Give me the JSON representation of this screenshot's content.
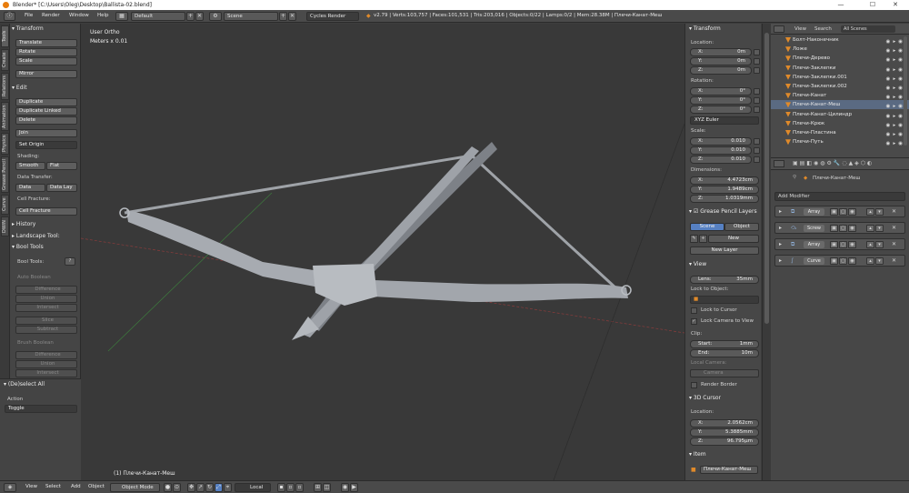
{
  "window": {
    "title": "Blender* [C:\\Users\\Oleg\\Desktop\\Ballista-02.blend]",
    "minimize": "—",
    "maximize": "☐",
    "close": "✕"
  },
  "topbar": {
    "menus": [
      "File",
      "Render",
      "Window",
      "Help"
    ],
    "screen_layout": "Default",
    "scene": "Scene",
    "engine": "Cycles Render",
    "stats": "v2.79 | Verts:103,757 | Faces:101,531 | Tris:203,016 | Objects:0/22 | Lamps:0/2 | Mem:28.38M | Плечи-Канат-Меш"
  },
  "vtabs": [
    "Tools",
    "Create",
    "Relations",
    "Animation",
    "Physics",
    "Grease Pencil",
    "Curve",
    "DWiN"
  ],
  "toolshelf": {
    "transform_header": "Transform",
    "translate": "Translate",
    "rotate": "Rotate",
    "scale": "Scale",
    "mirror": "Mirror",
    "edit_header": "Edit",
    "duplicate": "Duplicate",
    "duplicate_linked": "Duplicate Linked",
    "delete": "Delete",
    "join": "Join",
    "set_origin": "Set Origin",
    "shading_label": "Shading:",
    "smooth": "Smooth",
    "flat": "Flat",
    "data_transfer_label": "Data Transfer:",
    "data": "Data",
    "data_lay": "Data Lay",
    "cell_fracture_label": "Cell Fracture:",
    "cell_fracture": "Cell Fracture",
    "history": "History",
    "landscape_tools": "Landscape Tool:",
    "bool_tools_header": "Bool Tools",
    "bool_tools_label": "Bool Tools:",
    "auto_boolean": "Auto Boolean",
    "difference": "Difference",
    "union": "Union",
    "intersect": "Intersect",
    "slice": "Slice",
    "subtract": "Subtract",
    "brush_boolean": "Brush Boolean",
    "difference2": "Difference",
    "union2": "Union",
    "intersect2": "Intersect"
  },
  "operator_panel": {
    "header": "(De)select All",
    "action_label": "Action",
    "action_value": "Toggle"
  },
  "viewport": {
    "view_name": "User Ortho",
    "units": "Meters x 0.01",
    "object_label": "(1) Плечи-Канат-Меш"
  },
  "npanel": {
    "transform_header": "Transform",
    "location_label": "Location:",
    "loc_x": {
      "k": "X:",
      "v": "0m"
    },
    "loc_y": {
      "k": "Y:",
      "v": "0m"
    },
    "loc_z": {
      "k": "Z:",
      "v": "0m"
    },
    "rotation_label": "Rotation:",
    "rot_x": {
      "k": "X:",
      "v": "0°"
    },
    "rot_y": {
      "k": "Y:",
      "v": "0°"
    },
    "rot_z": {
      "k": "Z:",
      "v": "0°"
    },
    "rotation_mode": "XYZ Euler",
    "scale_label": "Scale:",
    "sc_x": {
      "k": "X:",
      "v": "0.010"
    },
    "sc_y": {
      "k": "Y:",
      "v": "0.010"
    },
    "sc_z": {
      "k": "Z:",
      "v": "0.010"
    },
    "dimensions_label": "Dimensions:",
    "dim_x": {
      "k": "X:",
      "v": "4.4723cm"
    },
    "dim_y": {
      "k": "Y:",
      "v": "1.9489cm"
    },
    "dim_z": {
      "k": "Z:",
      "v": "1.0319mm"
    },
    "grease_header": "Grease Pencil Layers",
    "scene_tab": "Scene",
    "object_tab": "Object",
    "new": "New",
    "new_layer": "New Layer",
    "view_header": "View",
    "lens": {
      "k": "Lens:",
      "v": "35mm"
    },
    "lock_object_label": "Lock to Object:",
    "lock_cursor": "Lock to Cursor",
    "lock_camera": "Lock Camera to View",
    "clip_label": "Clip:",
    "clip_start": {
      "k": "Start:",
      "v": "1mm"
    },
    "clip_end": {
      "k": "End:",
      "v": "10m"
    },
    "local_camera_label": "Local Camera:",
    "camera": "Camera",
    "render_border": "Render Border",
    "cursor_header": "3D Cursor",
    "cursor_location_label": "Location:",
    "cur_x": {
      "k": "X:",
      "v": "2.0562cm"
    },
    "cur_y": {
      "k": "Y:",
      "v": "5.3885mm"
    },
    "cur_z": {
      "k": "Z:",
      "v": "96.795µm"
    },
    "item_header": "Item",
    "item_name": "Плечи-Канат-Меш"
  },
  "outliner": {
    "view": "View",
    "search": "Search",
    "scenes": "All Scenes",
    "rows": [
      "Болт-Наконечник",
      "Ложе",
      "Плечи-Дерево",
      "Плечи-Заклепки",
      "Плечи-Заклепки.001",
      "Плечи-Заклепки.002",
      "Плечи-Канат",
      "Плечи-Канат-Меш",
      "Плечи-Канат-Цилиндр",
      "Плечи-Крюк",
      "Плечи-Пластина",
      "Плечи-Путь"
    ]
  },
  "properties": {
    "object_name": "Плечи-Канат-Меш",
    "add_modifier": "Add Modifier",
    "modifiers": [
      "Array",
      "Screw",
      "Array",
      "Curve"
    ]
  },
  "bottombar": {
    "menus": [
      "View",
      "Select",
      "Add",
      "Object"
    ],
    "mode": "Object Mode",
    "pivot": "Local"
  },
  "colors": {
    "accent": "#5680c2",
    "header": "#4a4a4a",
    "viewport": "#393939"
  }
}
